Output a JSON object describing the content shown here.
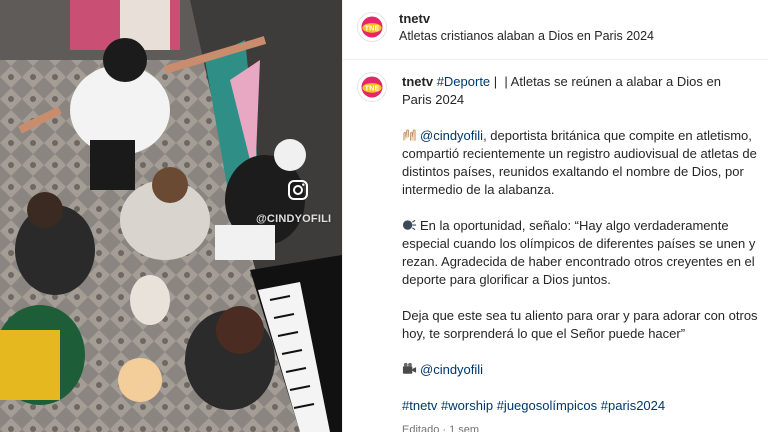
{
  "header": {
    "username": "tnetv",
    "subtitle": "Atletas cristianos alaban a Dios en Paris 2024"
  },
  "media": {
    "watermark": "@CINDYOFILI",
    "badge_icon": "instagram-icon"
  },
  "brand": {
    "logo_text": "TNE",
    "primary": "#e8246b",
    "accent": "#f7c21a"
  },
  "caption": {
    "username": "tnetv",
    "hashtag_deporte": "#Deporte",
    "title_rest_1": " |  | Atletas se reúnen a alabar a Dios en",
    "title_rest_2": "Paris 2024",
    "mention": "@cindyofili",
    "p1_rest_1": ", deportista británica que compite en atletismo,",
    "p1_line2": "compartió recientemente un registro audiovisual de atletas de",
    "p1_line3": "distintos países, reunidos exaltando el nombre de Dios, por",
    "p1_line4": "intermedio de la alabanza.",
    "p2_line1": "En la oportunidad, señalo: “Hay algo verdaderamente",
    "p2_line2": "especial cuando los olímpicos de diferentes países se unen y",
    "p2_line3": "rezan. Agradecida de haber encontrado otros creyentes en el",
    "p2_line4": "deporte para glorificar a Dios juntos.",
    "p3_line1": "Deja que este sea tu aliento para orar y para adorar con otros",
    "p3_line2": "hoy, te sorprenderá lo que el Señor puede hacer”",
    "credit_mention": "@cindyofili",
    "hashtags": [
      "#tnetv",
      "#worship",
      "#juegosolímpicos",
      "#paris2024"
    ],
    "meta": "Editado · 1 sem"
  }
}
